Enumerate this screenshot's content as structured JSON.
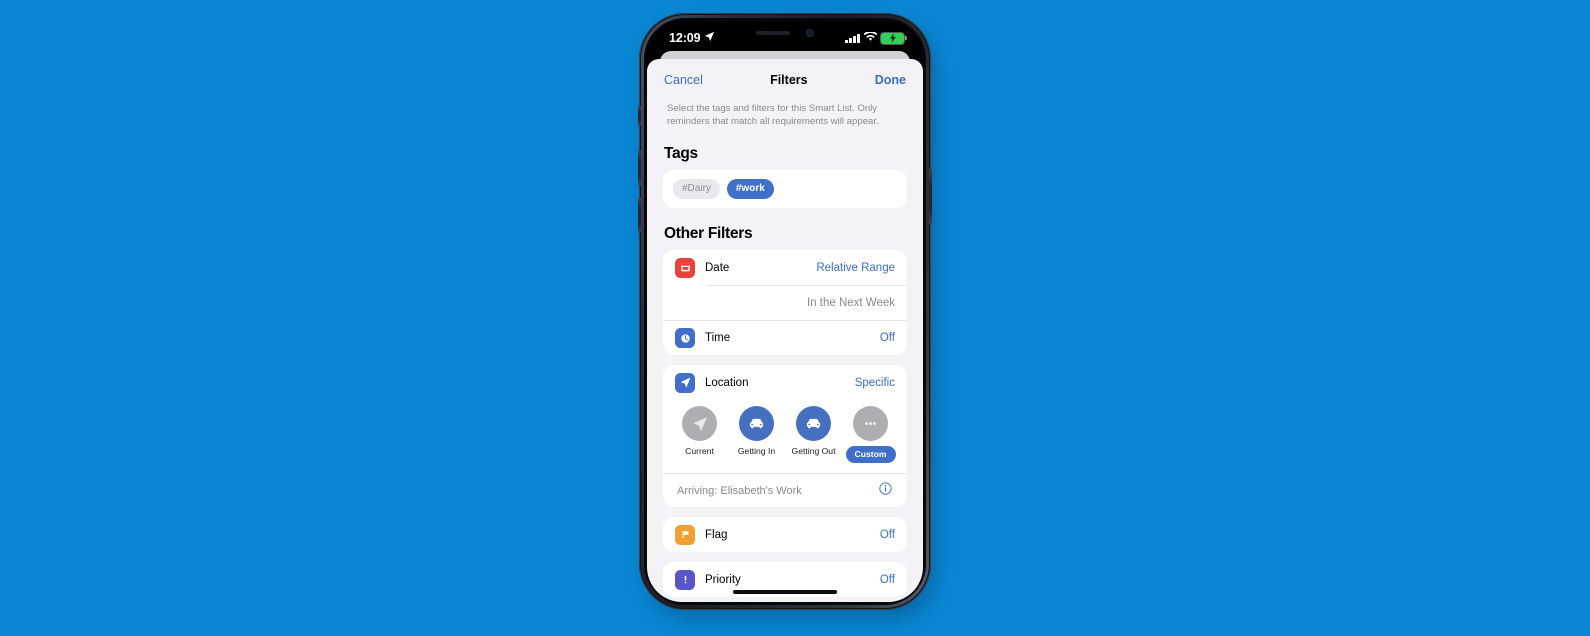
{
  "theme": {
    "background": "#0a87d4",
    "sheet_background": "#f2f2f7",
    "card_background": "#ffffff",
    "accent_blue": "#3a6fc4",
    "tag_selected": "#3f6fc9",
    "grey_circle": "#aeaeb2",
    "blue_circle": "#4470bf",
    "date_icon": "#e8423a",
    "time_icon": "#3f6fc9",
    "location_icon": "#3f6fc9",
    "flag_icon": "#f2a032",
    "priority_icon": "#5a56c8",
    "battery_green": "#30d158"
  },
  "status_bar": {
    "time": "12:09",
    "location_arrow_icon": "location-arrow-icon",
    "signal_icon": "cellular-signal-icon",
    "signal_bars": 4,
    "wifi_icon": "wifi-icon",
    "battery_icon": "battery-charging-icon",
    "battery_charging": true
  },
  "navbar": {
    "cancel_label": "Cancel",
    "title": "Filters",
    "done_label": "Done"
  },
  "intro_text": "Select the tags and filters for this Smart List. Only reminders that match all requirements will appear.",
  "tags_section": {
    "title": "Tags",
    "tags": [
      {
        "label": "#Dairy",
        "selected": false
      },
      {
        "label": "#work",
        "selected": true
      }
    ]
  },
  "other_filters": {
    "title": "Other Filters",
    "date_row": {
      "icon": "calendar-icon",
      "label": "Date",
      "value": "Relative Range",
      "detail": "In the Next Week"
    },
    "time_row": {
      "icon": "clock-icon",
      "label": "Time",
      "value": "Off"
    },
    "location_row": {
      "icon": "location-arrow-icon",
      "label": "Location",
      "value": "Specific",
      "options": [
        {
          "label": "Current",
          "icon": "location-arrow-icon",
          "circle": "grey",
          "selected": false
        },
        {
          "label": "Getting In",
          "icon": "car-icon",
          "circle": "blue",
          "selected": false
        },
        {
          "label": "Getting Out",
          "icon": "car-icon",
          "circle": "blue",
          "selected": false
        },
        {
          "label": "Custom",
          "icon": "ellipsis-icon",
          "circle": "grey",
          "selected": true
        }
      ],
      "arriving_text": "Arriving: Elisabeth's Work",
      "info_icon": "info-circle-icon"
    },
    "flag_row": {
      "icon": "flag-icon",
      "label": "Flag",
      "value": "Off"
    },
    "priority_row": {
      "icon": "exclamation-icon",
      "label": "Priority",
      "value": "Off"
    }
  }
}
